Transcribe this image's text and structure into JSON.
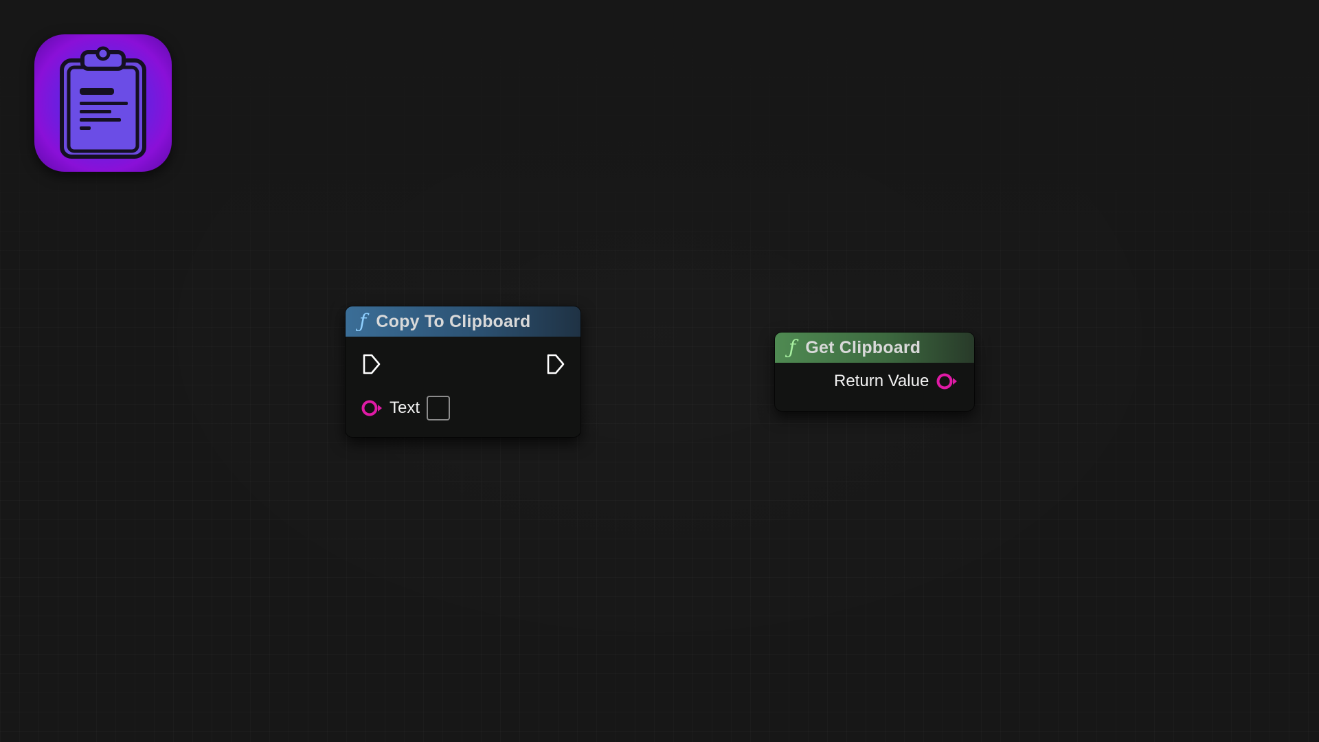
{
  "colors": {
    "background": "#171717",
    "string_pin": "#e01aa6",
    "exec_pin": "#ffffff",
    "copy_header": "#3b6e97",
    "get_header": "#4f8a52"
  },
  "app_icon": {
    "icon": "clipboard-icon"
  },
  "nodes": {
    "copy": {
      "title": "Copy To Clipboard",
      "func_glyph": "ƒ",
      "pins": {
        "text_label": "Text",
        "text_value": ""
      }
    },
    "get": {
      "title": "Get Clipboard",
      "func_glyph": "ƒ",
      "pins": {
        "return_label": "Return Value"
      }
    }
  }
}
